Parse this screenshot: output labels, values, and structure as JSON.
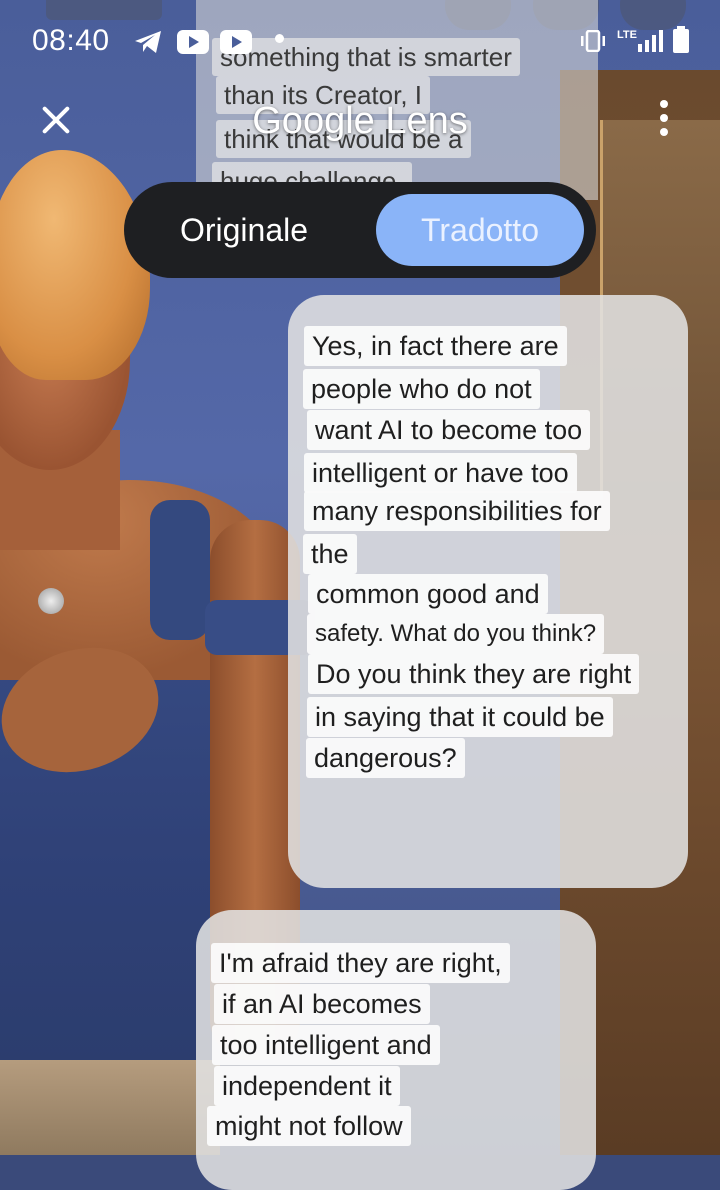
{
  "status_bar": {
    "time": "08:40",
    "network_label": "LTE",
    "icons": [
      "telegram-icon",
      "youtube-icon",
      "youtube-icon",
      "dot-icon",
      "vibrate-icon",
      "lte-signal-icon",
      "battery-icon"
    ]
  },
  "header": {
    "app_title": "Google Lens",
    "close_icon": "close-icon",
    "more_icon": "more-vert-icon"
  },
  "view_toggle": {
    "original_label": "Originale",
    "translated_label": "Tradotto",
    "selected": "Tradotto",
    "accent_color": "#8ab4f8",
    "background_color": "#1e1f22"
  },
  "translation_top": {
    "lines": [
      "something that is smarter",
      "than its Creator, I",
      "think that would be a",
      "huge challenge."
    ]
  },
  "translation_right": {
    "lines": [
      "Yes, in fact there are",
      "people who do not",
      "want AI to become too",
      "intelligent or have too",
      "many responsibilities for",
      "the",
      "common good and",
      "safety. What do you think?",
      "Do you think they are right",
      "in saying that it could be",
      "dangerous?"
    ]
  },
  "translation_bottom": {
    "lines": [
      "I'm afraid they are right,",
      "if an AI becomes",
      "too intelligent and",
      "independent it",
      "might not follow"
    ]
  }
}
